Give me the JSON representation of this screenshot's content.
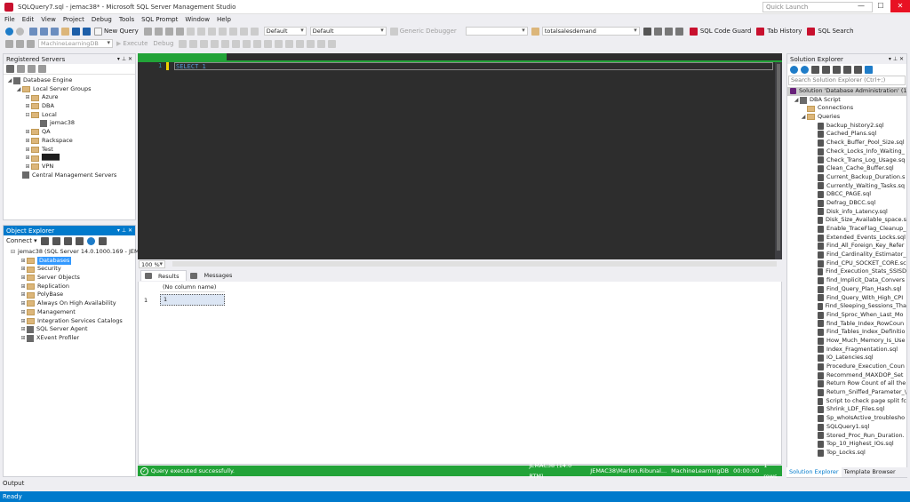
{
  "window": {
    "title": "SQLQuery7.sql - jemac38* - Microsoft SQL Server Management Studio",
    "quick_launch_placeholder": "Quick Launch",
    "min": "—",
    "max": "☐",
    "close": "✕"
  },
  "menu": [
    "File",
    "Edit",
    "View",
    "Project",
    "Debug",
    "Tools",
    "SQL Prompt",
    "Window",
    "Help"
  ],
  "toolbar1": {
    "new_query": "New Query",
    "combo1": "Default",
    "combo2": "Default",
    "generic_debugger": "Generic Debugger",
    "search_combo": "totalsalesdemand",
    "sql_code_guard": "SQL Code Guard",
    "tab_history": "Tab History",
    "sql_search": "SQL Search"
  },
  "toolbar2": {
    "database": "MachineLearningDB",
    "execute": "Execute",
    "debug": "Debug"
  },
  "registered_servers": {
    "title": "Registered Servers",
    "nodes": [
      {
        "label": "Database Engine",
        "level": 0,
        "exp": "◢",
        "type": "srv"
      },
      {
        "label": "Local Server Groups",
        "level": 1,
        "exp": "◢",
        "type": "folder"
      },
      {
        "label": "Azure",
        "level": 2,
        "exp": "⊞",
        "type": "folder"
      },
      {
        "label": "DBA",
        "level": 2,
        "exp": "⊞",
        "type": "folder"
      },
      {
        "label": "Local",
        "level": 2,
        "exp": "⊟",
        "type": "folder"
      },
      {
        "label": "jemac38",
        "level": 3,
        "exp": "",
        "type": "srv"
      },
      {
        "label": "QA",
        "level": 2,
        "exp": "⊞",
        "type": "folder"
      },
      {
        "label": "Rackspace",
        "level": 2,
        "exp": "⊞",
        "type": "folder"
      },
      {
        "label": "Test",
        "level": 2,
        "exp": "⊞",
        "type": "folder"
      },
      {
        "label": "████",
        "level": 2,
        "exp": "⊞",
        "type": "folder"
      },
      {
        "label": "VPN",
        "level": 2,
        "exp": "⊞",
        "type": "folder"
      },
      {
        "label": "Central Management Servers",
        "level": 1,
        "exp": "",
        "type": "srv"
      }
    ]
  },
  "object_explorer": {
    "title": "Object Explorer",
    "connect": "Connect ▾",
    "nodes": [
      {
        "label": "jemac38 (SQL Server 14.0.1000.169 - JEMAC",
        "level": 0,
        "exp": "⊟",
        "type": "srv"
      },
      {
        "label": "Databases",
        "level": 1,
        "exp": "⊞",
        "type": "folder",
        "selected": true
      },
      {
        "label": "Security",
        "level": 1,
        "exp": "⊞",
        "type": "folder"
      },
      {
        "label": "Server Objects",
        "level": 1,
        "exp": "⊞",
        "type": "folder"
      },
      {
        "label": "Replication",
        "level": 1,
        "exp": "⊞",
        "type": "folder"
      },
      {
        "label": "PolyBase",
        "level": 1,
        "exp": "⊞",
        "type": "folder"
      },
      {
        "label": "Always On High Availability",
        "level": 1,
        "exp": "⊞",
        "type": "folder"
      },
      {
        "label": "Management",
        "level": 1,
        "exp": "⊞",
        "type": "folder"
      },
      {
        "label": "Integration Services Catalogs",
        "level": 1,
        "exp": "⊞",
        "type": "folder"
      },
      {
        "label": "SQL Server Agent",
        "level": 1,
        "exp": "⊞",
        "type": "srv"
      },
      {
        "label": "XEvent Profiler",
        "level": 1,
        "exp": "⊞",
        "type": "srv"
      }
    ]
  },
  "editor": {
    "line": "1",
    "code": "SELECT 1",
    "zoom": "100 %"
  },
  "results": {
    "tab_results": "Results",
    "tab_messages": "Messages",
    "column": "(No column name)",
    "row_num": "1",
    "value": "1"
  },
  "status": {
    "message": "Query executed successfully.",
    "server": "JEMAC38 (14.0 RTM)",
    "user": "JEMAC38\\Marlon.Ribunal...",
    "db": "MachineLearningDB",
    "time": "00:00:00",
    "rows": "1 rows"
  },
  "solution_explorer": {
    "title": "Solution Explorer",
    "search": "Search Solution Explorer (Ctrl+;)",
    "solution": "Solution 'Database Administration' (1",
    "project": "DBA Script",
    "connections": "Connections",
    "queries": "Queries",
    "files": [
      "backup_history2.sql",
      "Cached_Plans.sql",
      "Check_Buffer_Pool_Size.sql",
      "Check_Locks_Info_Waiting_",
      "Check_Trans_Log_Usage.sq",
      "Clean_Cache_Buffer.sql",
      "Current_Backup_Duration.s",
      "Currently_Waiting_Tasks.sq",
      "DBCC_PAGE.sql",
      "Defrag_DBCC.sql",
      "Disk_info_Latency.sql",
      "Disk_Size_Available_space.s",
      "Enable_TraceFlag_Cleanup_",
      "Extended_Events_Locks.sql",
      "Find_All_Foreign_Key_Refer",
      "Find_Cardinality_Estimator_",
      "Find_CPU_SOCKET_CORE.sc",
      "Find_Execution_Stats_SSISD",
      "find_Implicit_Data_Convers",
      "Find_Query_Plan_Hash.sql",
      "Find_Query_With_High_CPI",
      "Find_Sleeping_Sessions_Tha",
      "Find_Sproc_When_Last_Mo",
      "find_Table_Index_RowCoun",
      "Find_Tables_Index_Definitio",
      "How_Much_Memory_Is_Use",
      "Index_Fragmentation.sql",
      "IO_Latencies.sql",
      "Procedure_Execution_Coun",
      "Recommend_MAXDOP_Set",
      "Return Row Count of all the",
      "Return_Sniffed_Parameter_\\",
      "Script to check page split fc",
      "Shrink_LDF_Files.sql",
      "Sp_whoIsActive_troublesho",
      "SQLQuery1.sql",
      "Stored_Proc_Run_Duration.",
      "Top_10_Highest_IOs.sql",
      "Top_Locks.sql"
    ],
    "tab_solution": "Solution Explorer",
    "tab_template": "Template Browser"
  },
  "output_label": "Output",
  "ready": "Ready",
  "colors": {
    "accent": "#007acc",
    "success": "#22a338",
    "editor_bg": "#2d2d2d"
  }
}
